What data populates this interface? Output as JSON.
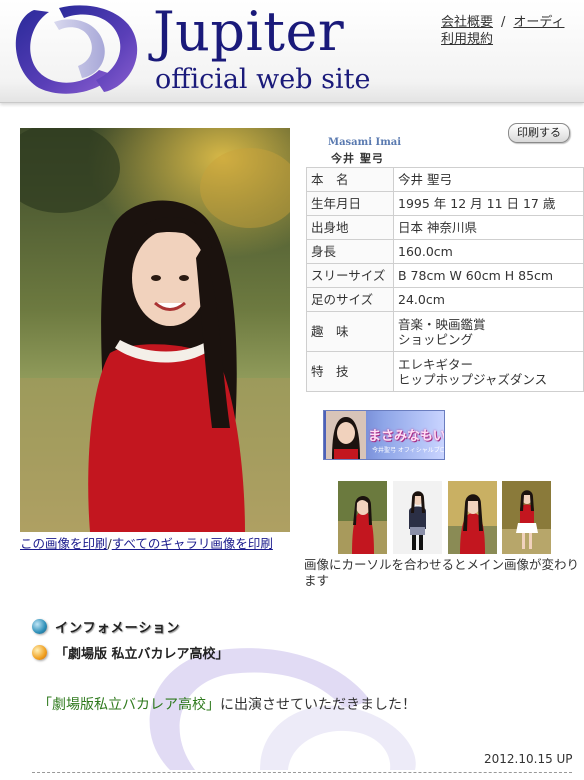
{
  "header": {
    "logo_title": "Jupiter",
    "logo_subtitle": "official web site",
    "links": [
      "会社概要",
      "オーディ",
      "利用規約"
    ]
  },
  "photo": {
    "print_image_link": "この画像を印刷",
    "separator": "/",
    "print_all_link": "すべてのギャラリ画像を印刷"
  },
  "print_button_label": "印刷する",
  "profile": {
    "name_romaji": "Masami Imai",
    "name_kanji": "今井 聖弓",
    "rows": [
      {
        "label": "本　名",
        "value": "今井 聖弓"
      },
      {
        "label": "生年月日",
        "value": "1995 年 12 月 11 日 17 歳"
      },
      {
        "label": "出身地",
        "value": "日本 神奈川県"
      },
      {
        "label": "身長",
        "value": "160.0cm"
      },
      {
        "label": "スリーサイズ",
        "value": "B 78cm W 60cm H 85cm"
      },
      {
        "label": "足のサイズ",
        "value": "24.0cm"
      },
      {
        "label": "趣　味",
        "value": "音楽・映画鑑賞",
        "value2": "ショッピング"
      },
      {
        "label": "特　技",
        "value": "エレキギター",
        "value2": "ヒップホップジャズダンス"
      }
    ]
  },
  "blog_banner": {
    "text": "まさみなもいふ",
    "subtext": "今井聖弓 オフィシャルブログ"
  },
  "thumbnails_caption": "画像にカーソルを合わせるとメイン画像が変わります",
  "info": {
    "heading": "インフォメーション",
    "item": "「劇場版 私立バカレア高校」"
  },
  "news": {
    "highlight": "「劇場版私立バカレア高校」",
    "text": "に出演させていただきました！",
    "date": "2012.10.15 UP"
  },
  "colors": {
    "logo_blue": "#1a1a7a",
    "link_blue": "#1a1a8c",
    "news_green": "#2f7a1e"
  }
}
